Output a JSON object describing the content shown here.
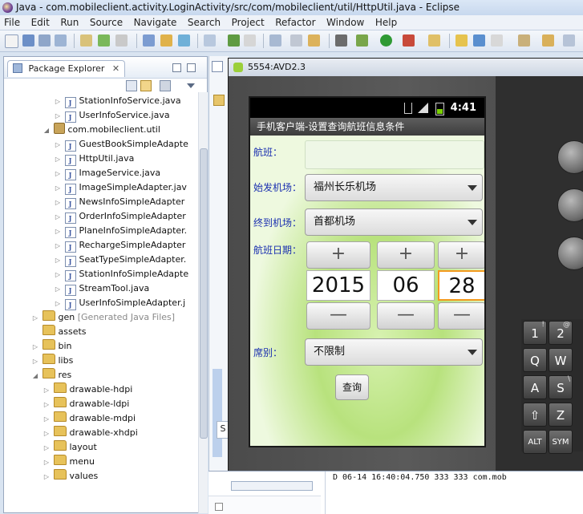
{
  "window": {
    "title": "Java - com.mobileclient.activity.LoginActivity/src/com/mobileclient/util/HttpUtil.java - Eclipse"
  },
  "menu": [
    "File",
    "Edit",
    "Run",
    "Source",
    "Navigate",
    "Search",
    "Project",
    "Refactor",
    "Window",
    "Help"
  ],
  "package_explorer": {
    "tab_label": "Package Explorer",
    "close_glyph": "✕",
    "tree": [
      {
        "label": "StationInfoService.java",
        "type": "java"
      },
      {
        "label": "UserInfoService.java",
        "type": "java"
      },
      {
        "label": "com.mobileclient.util",
        "type": "package"
      },
      {
        "label": "GuestBookSimpleAdapte",
        "type": "java"
      },
      {
        "label": "HttpUtil.java",
        "type": "java"
      },
      {
        "label": "ImageService.java",
        "type": "java"
      },
      {
        "label": "ImageSimpleAdapter.jav",
        "type": "java"
      },
      {
        "label": "NewsInfoSimpleAdapter",
        "type": "java"
      },
      {
        "label": "OrderInfoSimpleAdapter",
        "type": "java"
      },
      {
        "label": "PlaneInfoSimpleAdapter.",
        "type": "java"
      },
      {
        "label": "RechargeSimpleAdapter",
        "type": "java"
      },
      {
        "label": "SeatTypeSimpleAdapter.",
        "type": "java"
      },
      {
        "label": "StationInfoSimpleAdapte",
        "type": "java"
      },
      {
        "label": "StreamTool.java",
        "type": "java"
      },
      {
        "label": "UserInfoSimpleAdapter.j",
        "type": "java"
      },
      {
        "label": "gen",
        "suffix": "[Generated Java Files]",
        "type": "folder"
      },
      {
        "label": "assets",
        "type": "folder"
      },
      {
        "label": "bin",
        "type": "folder"
      },
      {
        "label": "libs",
        "type": "folder"
      },
      {
        "label": "res",
        "type": "folder"
      },
      {
        "label": "drawable-hdpi",
        "type": "folder"
      },
      {
        "label": "drawable-ldpi",
        "type": "folder"
      },
      {
        "label": "drawable-mdpi",
        "type": "folder"
      },
      {
        "label": "drawable-xhdpi",
        "type": "folder"
      },
      {
        "label": "layout",
        "type": "folder"
      },
      {
        "label": "menu",
        "type": "folder"
      },
      {
        "label": "values",
        "type": "folder"
      }
    ]
  },
  "emulator": {
    "title": "5554:AVD2.3",
    "status_time": "4:41",
    "app_title": "手机客户端-设置查询航班信息条件",
    "form": {
      "flight_label": "航班：",
      "flight_value": "",
      "depart_label": "始发机场：",
      "depart_value": "福州长乐机场",
      "arrive_label": "终到机场：",
      "arrive_value": "首都机场",
      "date_label": "航班日期：",
      "year": "2015",
      "month": "06",
      "day": "28",
      "plus": "+",
      "minus": "—",
      "seat_label": "席别：",
      "seat_value": "不限制",
      "query_button": "查询"
    },
    "keys": [
      {
        "main": "1",
        "alt": "!"
      },
      {
        "main": "2",
        "alt": "@"
      },
      {
        "main": "Q",
        "alt": ""
      },
      {
        "main": "W",
        "alt": ""
      },
      {
        "main": "A",
        "alt": ""
      },
      {
        "main": "S",
        "alt": "\\"
      },
      {
        "main": "⇧",
        "alt": ""
      },
      {
        "main": "Z",
        "alt": ""
      },
      {
        "main": "ALT",
        "alt": ""
      },
      {
        "main": "SYM",
        "alt": ""
      }
    ]
  },
  "console": {
    "log_line": "D   06-14 16:40:04.750   333   333   com.mob"
  },
  "colors": {
    "accent_orange": "#f39a1e",
    "label_blue": "#1a2fb0",
    "screen_green": "#b8e27d"
  }
}
